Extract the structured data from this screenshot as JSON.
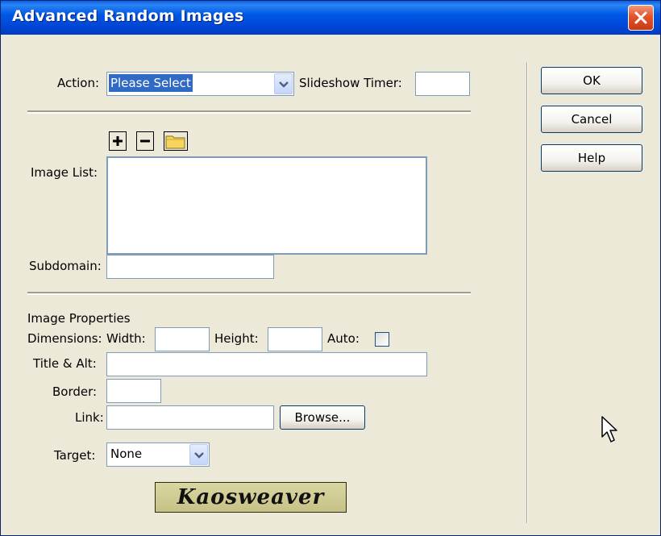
{
  "window": {
    "title": "Advanced Random Images"
  },
  "action": {
    "label": "Action:",
    "selected": "Please Select"
  },
  "slideshow": {
    "label": "Slideshow Timer:",
    "value": ""
  },
  "image_list": {
    "label": "Image List:",
    "tools": [
      "+",
      "−",
      "folder-icon"
    ]
  },
  "subdomain": {
    "label": "Subdomain:",
    "value": ""
  },
  "properties": {
    "heading": "Image Properties",
    "dimensions_label": "Dimensions:",
    "width_label": "Width:",
    "height_label": "Height:",
    "auto_label": "Auto:",
    "title_alt_label": "Title & Alt:",
    "border_label": "Border:",
    "link_label": "Link:",
    "browse_label": "Browse...",
    "target_label": "Target:",
    "target_value": "None"
  },
  "buttons": {
    "ok": "OK",
    "cancel": "Cancel",
    "help": "Help"
  },
  "logo": {
    "text": "Kaosweaver"
  },
  "colors": {
    "titlebar": "#0058e6",
    "dialog_bg": "#ece9d8",
    "selection": "#316ac5",
    "close": "#e2542d"
  }
}
